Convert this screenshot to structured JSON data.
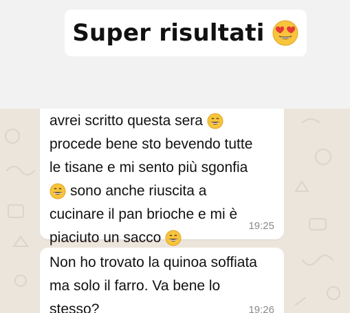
{
  "header": {
    "title": "Super risultati",
    "title_emoji_icon": "heart-eyes-emoji-icon"
  },
  "messages": [
    {
      "lines": [
        {
          "text": "avrei scritto questa sera",
          "emoji_after": "grinning-emoji-icon"
        },
        {
          "text": "procede bene sto bevendo tutte"
        },
        {
          "text": "le tisane e mi sento più sgonfia"
        },
        {
          "emoji_before": "grinning-emoji-icon",
          "text": "sono anche riuscita a"
        },
        {
          "text": "cucinare il pan brioche e mi è"
        },
        {
          "text": "piaciuto un sacco",
          "emoji_after": "grinning-emoji-icon"
        }
      ],
      "time": "19:25"
    },
    {
      "lines": [
        {
          "text": "Non ho trovato la quinoa soffiata"
        },
        {
          "text": "ma solo il farro. Va bene lo"
        },
        {
          "text": "stesso?"
        }
      ],
      "time": "19:26"
    }
  ],
  "colors": {
    "chat_background": "#ece5dc",
    "bubble": "#ffffff",
    "timestamp": "#8a8a8a"
  }
}
